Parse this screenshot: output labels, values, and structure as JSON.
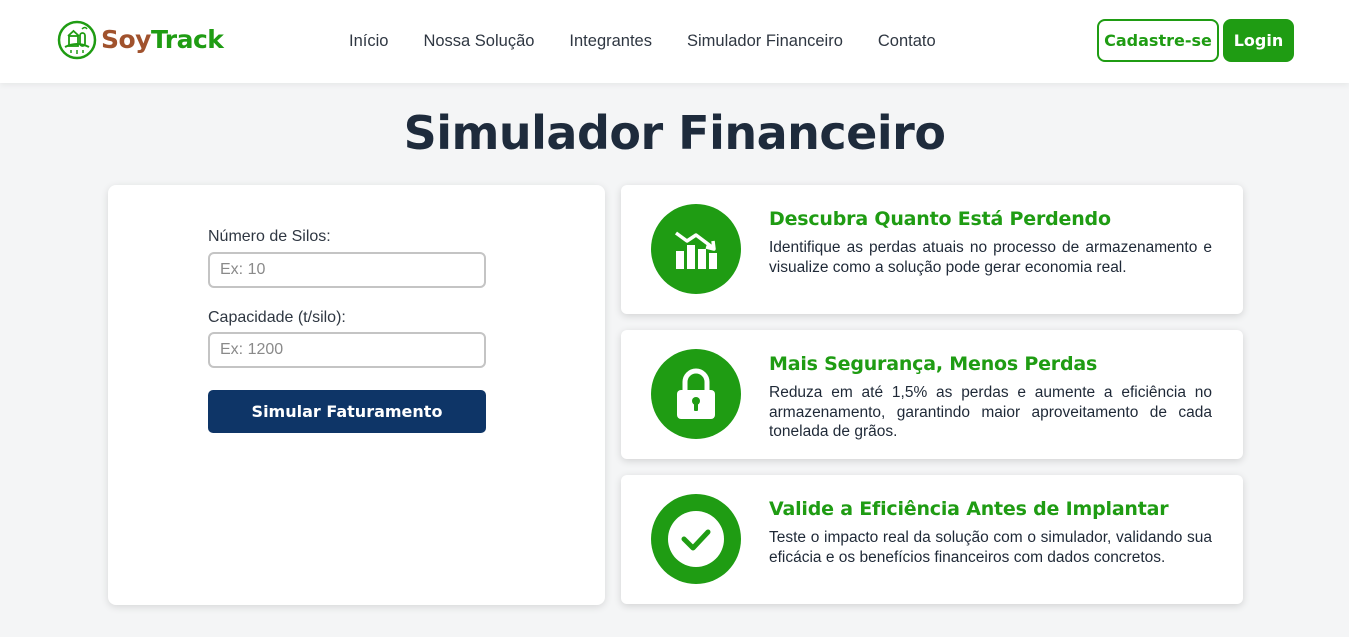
{
  "brand": {
    "soy": "Soy",
    "track": "Track",
    "logo_color": "#1f9c13",
    "soy_color": "#a0522d"
  },
  "nav": {
    "items": [
      "Início",
      "Nossa Solução",
      "Integrantes",
      "Simulador Financeiro",
      "Contato"
    ],
    "signup_label": "Cadastre-se",
    "login_label": "Login"
  },
  "page": {
    "title": "Simulador Financeiro"
  },
  "form": {
    "silos_label": "Número de Silos:",
    "silos_placeholder": "Ex: 10",
    "silos_value": "",
    "capacity_label": "Capacidade (t/silo):",
    "capacity_placeholder": "Ex: 1200",
    "capacity_value": "",
    "submit_label": "Simular Faturamento",
    "submit_color": "#0e3567"
  },
  "features": [
    {
      "icon": "chart-icon",
      "title": "Descubra Quanto Está Perdendo",
      "description": "Identifique as perdas atuais no processo de armazenamento e visualize como a solução pode gerar economia real."
    },
    {
      "icon": "lock-icon",
      "title": "Mais Segurança, Menos Perdas",
      "description": "Reduza em até 1,5% as perdas e aumente a eficiência no armazenamento, garantindo maior aproveitamento de cada tonelada de grãos."
    },
    {
      "icon": "check-circle-icon",
      "title": "Valide a Eficiência Antes de Implantar",
      "description": "Teste o impacto real da solução com o simulador, validando sua eficácia e os benefícios financeiros com dados concretos."
    }
  ],
  "colors": {
    "accent": "#1f9c13",
    "primary_dark": "#0e3567",
    "background": "#f4f5f6"
  }
}
